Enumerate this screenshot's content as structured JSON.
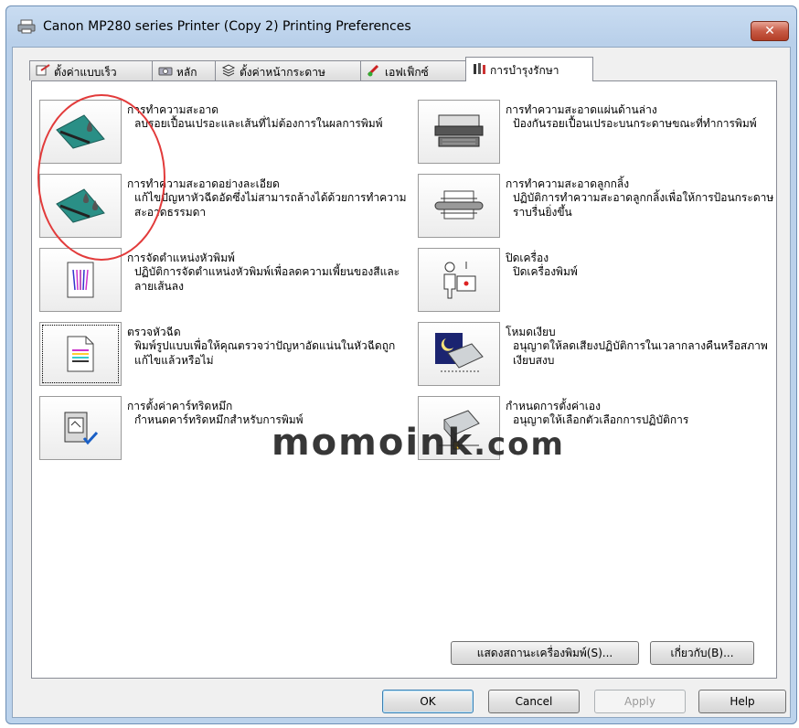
{
  "window": {
    "title": "Canon MP280 series Printer (Copy 2) Printing Preferences",
    "close_label": "✕"
  },
  "tabs": [
    {
      "label": "ตั้งค่าแบบเร็ว",
      "icon": "quick-setup-icon"
    },
    {
      "label": "หลัก",
      "icon": "main-icon"
    },
    {
      "label": "ตั้งค่าหน้ากระดาษ",
      "icon": "page-setup-icon"
    },
    {
      "label": "เอฟเฟ็กซ์",
      "icon": "effects-icon"
    },
    {
      "label": "การบำรุงรักษา",
      "icon": "maintenance-icon",
      "active": true
    }
  ],
  "left_items": [
    {
      "title": "การทำความสะอาด",
      "desc": "ลบรอยเปื้อนเปรอะและเส้นที่ไม่ต้องการในผลการพิมพ์",
      "icon": "cleaning-icon"
    },
    {
      "title": "การทำความสะอาดอย่างละเอียด",
      "desc": "แก้ไขปัญหาหัวฉีดอัดซึ่งไม่สามารถล้างได้ด้วยการทำความสะอาดธรรมดา",
      "icon": "deep-cleaning-icon"
    },
    {
      "title": "การจัดตำแหน่งหัวพิมพ์",
      "desc": "ปฏิบัติการจัดตำแหน่งหัวพิมพ์เพื่อลดความเพี้ยนของสีและลายเส้นลง",
      "icon": "print-head-alignment-icon"
    },
    {
      "title": "ตรวจหัวฉีด",
      "desc": "พิมพ์รูปแบบเพื่อให้คุณตรวจว่าปัญหาอัดแน่นในหัวฉีดถูกแก้ไขแล้วหรือไม่",
      "icon": "nozzle-check-icon"
    },
    {
      "title": "การตั้งค่าคาร์ทริดหมึก",
      "desc": "กำหนดคาร์ทริดหมึกสำหรับการพิมพ์",
      "icon": "ink-cartridge-settings-icon"
    }
  ],
  "right_items": [
    {
      "title": "การทำความสะอาดแผ่นด้านล่าง",
      "desc": "ป้องกันรอยเปื้อนเปรอะบนกระดาษขณะที่ทำการพิมพ์",
      "icon": "bottom-plate-cleaning-icon"
    },
    {
      "title": "การทำความสะอาดลูกกลิ้ง",
      "desc": "ปฏิบัติการทำความสะอาดลูกกลิ้งเพื่อให้การป้อนกระดาษราบรื่นยิ่งขึ้น",
      "icon": "roller-cleaning-icon"
    },
    {
      "title": "ปิดเครื่อง",
      "desc": "ปิดเครื่องพิมพ์",
      "icon": "power-off-icon"
    },
    {
      "title": "โหมดเงียบ",
      "desc": "อนุญาตให้ลดเสียงปฏิบัติการในเวลากลางคืนหรือสภาพเงียบสงบ",
      "icon": "quiet-mode-icon"
    },
    {
      "title": "กำหนดการตั้งค่าเอง",
      "desc": "อนุญาตให้เลือกตัวเลือกการปฏิบัติการ",
      "icon": "custom-settings-icon"
    }
  ],
  "panel_buttons": {
    "status": "แสดงสถานะเครื่องพิมพ์(S)...",
    "about": "เกี่ยวกับ(B)..."
  },
  "footer": {
    "ok": "OK",
    "cancel": "Cancel",
    "apply": "Apply",
    "help": "Help"
  },
  "watermark": {
    "brand": "momoink",
    "tld": ".com"
  },
  "colors": {
    "accent_teal": "#2a8f86",
    "annotation_red": "#e23b3b"
  }
}
